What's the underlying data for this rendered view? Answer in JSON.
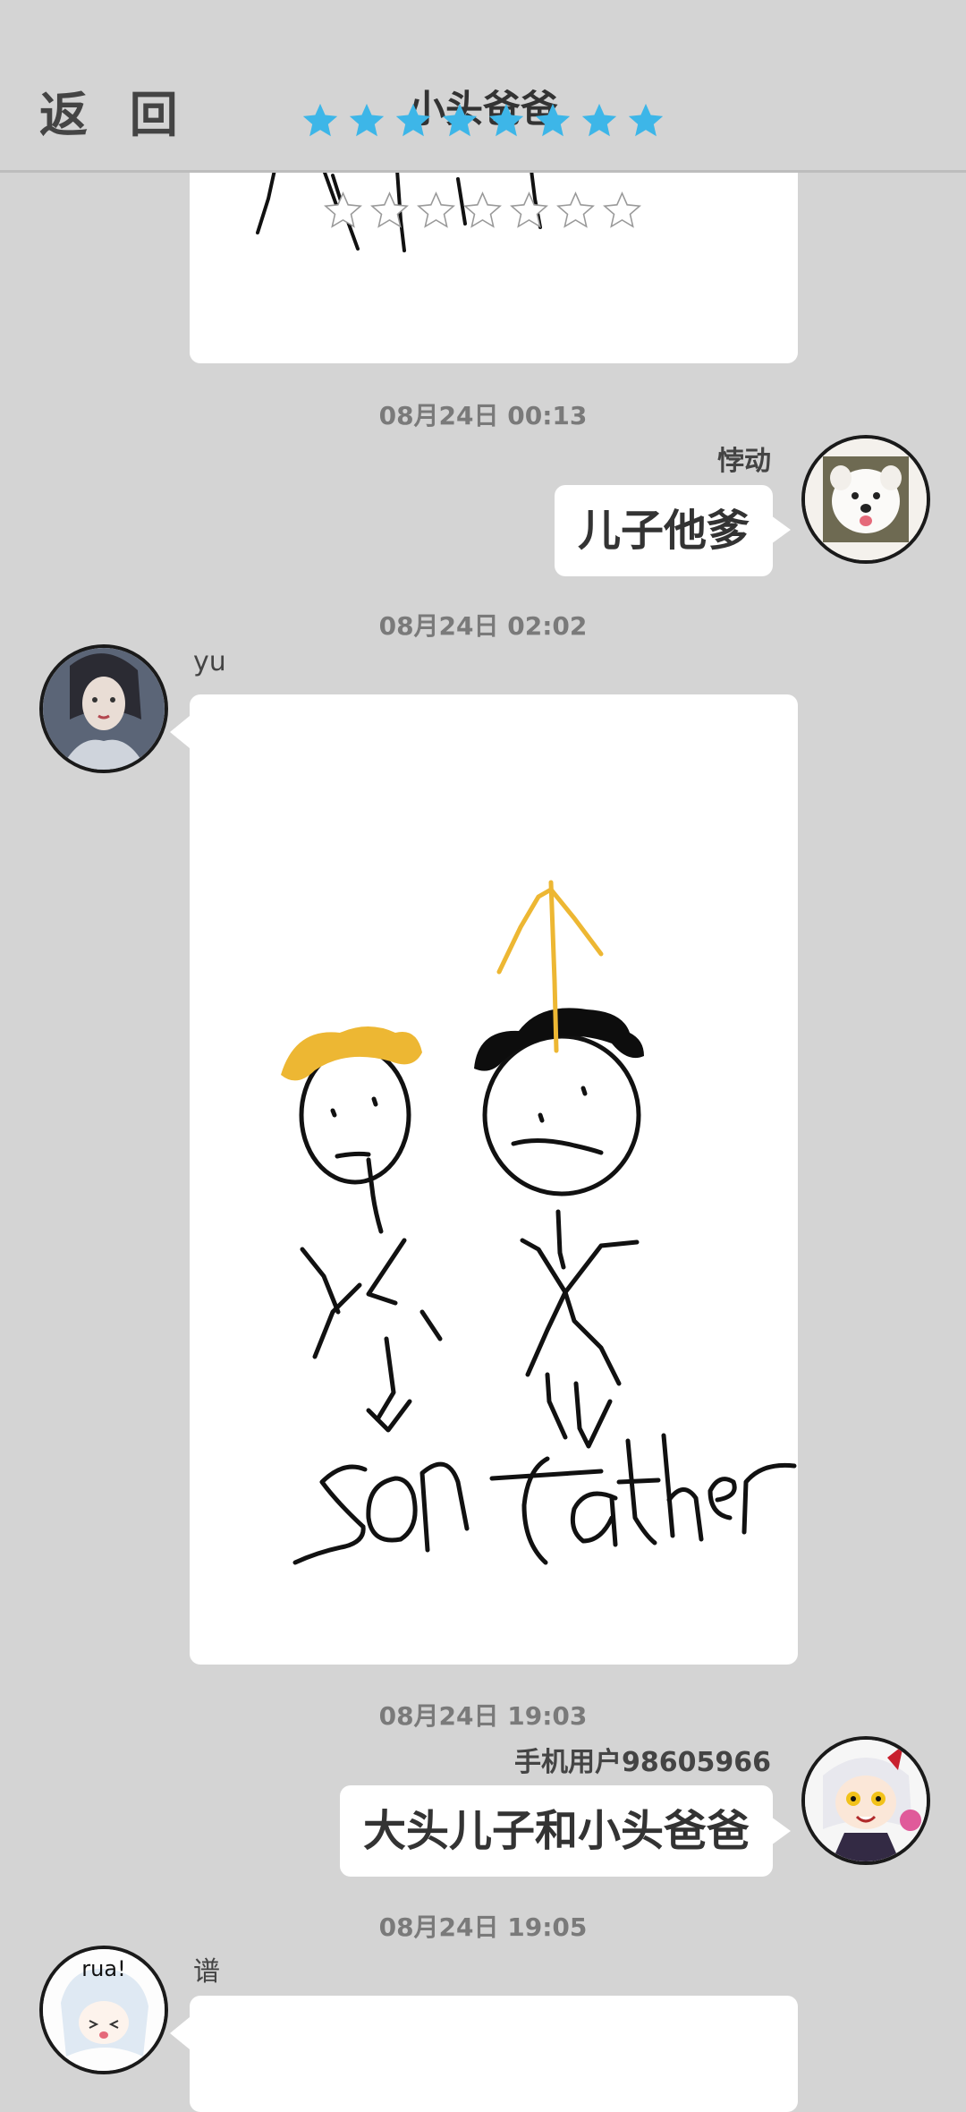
{
  "header": {
    "back_label": "返 回",
    "title": "小头爸爸",
    "star_color": "#3db6e8"
  },
  "messages": [
    {
      "type": "timestamp",
      "text": "08月24日  00:13"
    },
    {
      "type": "text",
      "side": "right",
      "sender": "悖动",
      "text": "儿子他爹",
      "avatar": "dog-avatar"
    },
    {
      "type": "timestamp",
      "text": "08月24日  02:02"
    },
    {
      "type": "drawing",
      "side": "left",
      "sender": "yu",
      "avatar": "girl-avatar",
      "drawing_labels": {
        "left": "son",
        "right": "father"
      }
    },
    {
      "type": "timestamp",
      "text": "08月24日  19:03"
    },
    {
      "type": "text",
      "side": "right",
      "sender": "手机用户98605966",
      "text": "大头儿子和小头爸爸",
      "avatar": "anime-avatar"
    },
    {
      "type": "timestamp",
      "text": "08月24日  19:05"
    },
    {
      "type": "drawing",
      "side": "left",
      "sender": "谱",
      "avatar": "chibi-avatar",
      "avatar_text": "rua!"
    }
  ]
}
